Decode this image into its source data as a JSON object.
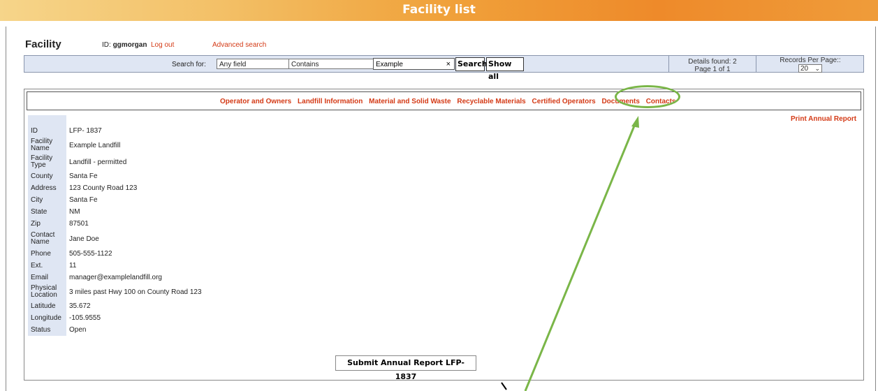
{
  "window": {
    "title": "Facility list"
  },
  "header": {
    "section_title": "Facility",
    "id_label": "ID:",
    "username": "ggmorgan",
    "logout_label": "Log out",
    "advanced_search_label": "Advanced search"
  },
  "search": {
    "label": "Search for:",
    "field_selected": "Any field",
    "operator_selected": "Contains",
    "query_value": "Example",
    "search_button": "Search",
    "show_all_button": "Show all",
    "details_found": "Details found: 2",
    "page_info": "Page 1 of 1",
    "records_per_page_label": "Records Per Page::",
    "records_per_page_value": "20"
  },
  "tabs": [
    {
      "label": "Operator and Owners"
    },
    {
      "label": "Landfill Information"
    },
    {
      "label": "Material and Solid Waste"
    },
    {
      "label": "Recyclable Materials"
    },
    {
      "label": "Certified Operators"
    },
    {
      "label": "Documents"
    },
    {
      "label": "Contacts"
    }
  ],
  "print_annual_report_label": "Print Annual Report",
  "details": [
    {
      "key": "ID",
      "value": "LFP- 1837"
    },
    {
      "key": "Facility Name",
      "value": "Example Landfill"
    },
    {
      "key": "Facility Type",
      "value": "Landfill - permitted"
    },
    {
      "key": "County",
      "value": "Santa Fe"
    },
    {
      "key": "Address",
      "value": "123 County Road 123"
    },
    {
      "key": "City",
      "value": "Santa Fe"
    },
    {
      "key": "State",
      "value": "NM"
    },
    {
      "key": "Zip",
      "value": "87501"
    },
    {
      "key": "Contact Name",
      "value": "Jane Doe"
    },
    {
      "key": "Phone",
      "value": "505-555-1122"
    },
    {
      "key": "Ext.",
      "value": "11"
    },
    {
      "key": "Email",
      "value": "manager@examplelandfill.org"
    },
    {
      "key": "Physical Location",
      "value": "3 miles past Hwy 100 on County Road 123"
    },
    {
      "key": "Latitude",
      "value": "35.672"
    },
    {
      "key": "Longitude",
      "value": "-105.9555"
    },
    {
      "key": "Status",
      "value": "Open"
    }
  ],
  "submit_button": "Submit Annual Report LFP- 1837",
  "colors": {
    "link": "#d43a16",
    "annotation": "#7ab648",
    "search_bar_bg": "#dfe6f3"
  },
  "annotation": {
    "highlighted_tab": "Contacts"
  }
}
